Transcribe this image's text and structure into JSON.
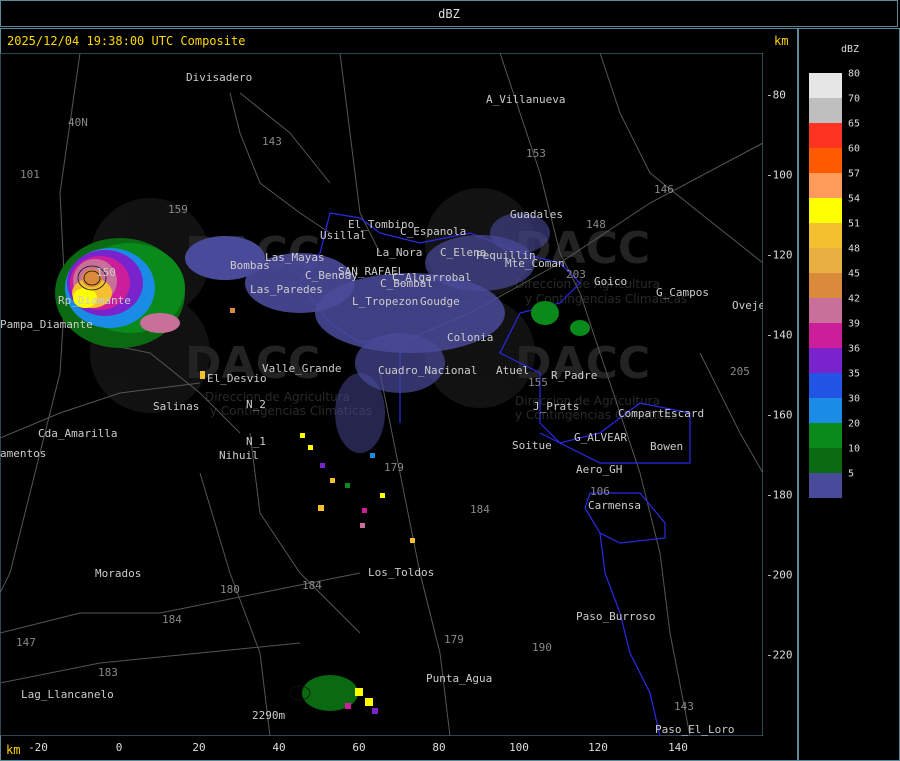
{
  "header": {
    "title": "dBZ"
  },
  "map": {
    "timestamp": "2025/12/04 19:38:00 UTC Composite",
    "unit_top": "km",
    "unit_bottom": "km",
    "x_ticks": [
      "-20",
      "0",
      "20",
      "40",
      "60",
      "80",
      "100",
      "120",
      "140"
    ],
    "y_ticks": [
      "-80",
      "-100",
      "-120",
      "-140",
      "-160",
      "-180",
      "-200",
      "-220"
    ],
    "places": [
      "Divisadero",
      "A_Villanueva",
      "40N",
      "101",
      "Usillal",
      "El_Tombino",
      "C_Espanola",
      "La_Nora",
      "C_Elena",
      "Guadales",
      "Pequillin",
      "Mte_Coman",
      "C_Benoay",
      "SAN_RAFAEL",
      "C_Algarrobal",
      "C_Bombal",
      "Goudge",
      "L_Tropezon",
      "Colonia",
      "Goico",
      "G_Campos",
      "Ovejeros",
      "Pampa_Diamante",
      "Rp_Diamante",
      "Bombas",
      "Las_Mayas",
      "Las_Paredes",
      "Valle_Grande",
      "El_Desvio",
      "Salinas",
      "N_2",
      "N_1",
      "Cda_Amarilla",
      "amentos",
      "Nihuil",
      "Cuadro_Nacional",
      "Atuel",
      "R_Padre",
      "J_Prats",
      "CompartEscard",
      "G_ALVEAR",
      "Soitue",
      "Bowen",
      "Aero_GH",
      "Carmensa",
      "Los_Toldos",
      "Morados",
      "Paso_Burroso",
      "Punta_Agua",
      "Lag_Llancanelo",
      "Paso_El_Loro",
      "2290m",
      "150",
      "153",
      "146",
      "148",
      "203",
      "205",
      "159",
      "143",
      "183",
      "179",
      "180",
      "184",
      "190",
      "147",
      "106",
      "155"
    ],
    "watermark": [
      "DACC",
      "Direccion de Agricultura",
      "y Contingencias Climaticas"
    ]
  },
  "legend": {
    "title": "dBZ",
    "items": [
      {
        "label": "80",
        "color": "#e6e6e6"
      },
      {
        "label": "70",
        "color": "#bfbfbf"
      },
      {
        "label": "65",
        "color": "#ff3322"
      },
      {
        "label": "60",
        "color": "#ff5a00"
      },
      {
        "label": "57",
        "color": "#ff9a5a"
      },
      {
        "label": "54",
        "color": "#ffff00"
      },
      {
        "label": "51",
        "color": "#f5c030"
      },
      {
        "label": "48",
        "color": "#e8b040"
      },
      {
        "label": "45",
        "color": "#d98a3a"
      },
      {
        "label": "42",
        "color": "#c8709a"
      },
      {
        "label": "39",
        "color": "#cc1e9a"
      },
      {
        "label": "36",
        "color": "#7a22cc"
      },
      {
        "label": "35",
        "color": "#2255e6"
      },
      {
        "label": "30",
        "color": "#1a8ce6"
      },
      {
        "label": "20",
        "color": "#0a8a1a"
      },
      {
        "label": "10",
        "color": "#0a6a12"
      },
      {
        "label": "5",
        "color": "#4a4a9a"
      }
    ]
  }
}
